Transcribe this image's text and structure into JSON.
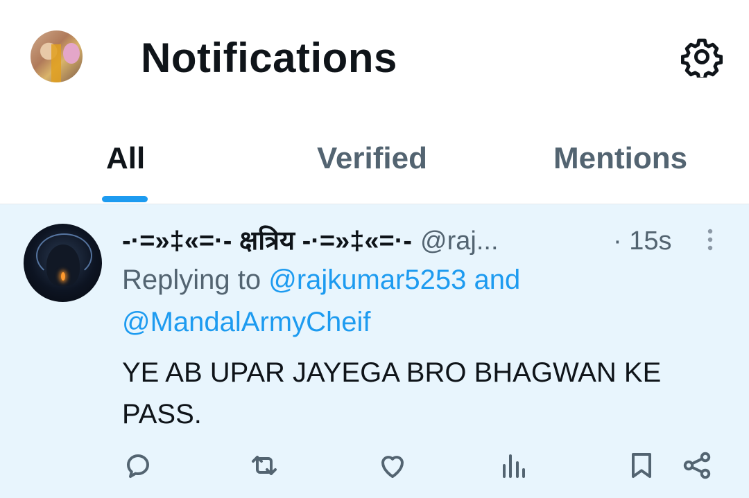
{
  "header": {
    "title": "Notifications"
  },
  "tabs": [
    {
      "label": "All",
      "active": true
    },
    {
      "label": "Verified",
      "active": false
    },
    {
      "label": "Mentions",
      "active": false
    }
  ],
  "notification": {
    "display_name": "-·=»‡«=·- क्षत्रिय -·=»‡«=·-",
    "handle": "@raj...",
    "time": "· 15s",
    "replying_prefix": "Replying to ",
    "mention_1": "@rajkumar5253",
    "and_text": " and",
    "mention_2": "@MandalArmyCheif",
    "text": "YE AB UPAR JAYEGA BRO BHAGWAN KE PASS."
  },
  "actions": [
    "reply-icon",
    "retweet-icon",
    "like-icon",
    "views-icon",
    "bookmark-icon",
    "share-icon"
  ],
  "colors": {
    "accent": "#1d9bf0",
    "secondary_text": "#536471",
    "card_background": "#e8f5fd"
  }
}
